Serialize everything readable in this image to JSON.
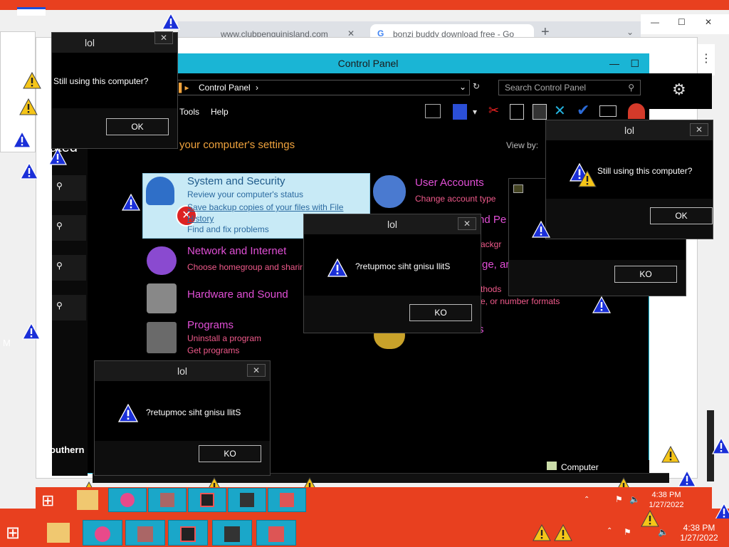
{
  "browser": {
    "tab1": "www.clubpenguinisland.com",
    "tab2": "bonzi buddy download free - Go",
    "new_tab": "+"
  },
  "control_panel": {
    "title": "Control Panel",
    "address": "Control Panel",
    "search_placeholder": "Search Control Panel",
    "menu": [
      "Tools",
      "Help"
    ],
    "heading": "your computer's settings",
    "view_by": "View by:",
    "categories": [
      {
        "title": "System and Security",
        "links": [
          "Review your computer's status",
          "Save backup copies of your files with File History",
          "Find and fix problems"
        ]
      },
      {
        "title": "Network and Internet",
        "links": [
          "Choose homegroup and sharing options"
        ]
      },
      {
        "title": "Hardware and Sound",
        "links": []
      },
      {
        "title": "Programs",
        "links": [
          "Uninstall a program",
          "Get programs"
        ]
      },
      {
        "title": "User Accounts",
        "links": [
          "Change account type"
        ]
      },
      {
        "title_fragment": "nd Pe",
        "links": [
          "ackgr"
        ]
      },
      {
        "title_fragment": "ge, ar",
        "links": [
          "thods",
          "e, or number formats"
        ]
      },
      {
        "title_fragment": "s",
        "links": []
      }
    ],
    "status_computer": "Computer"
  },
  "sidebar": {
    "fragment_top": "ated",
    "fragment_bottom": "outhern"
  },
  "dialogs": {
    "title": "lol",
    "message_normal": "Still using this computer?",
    "message_reversed": "?retupmoc siht gnisu llitS",
    "ok": "OK",
    "ko": "KO",
    "close": "✕"
  },
  "taskbar": {
    "time1": "4:38 PM",
    "date1": "1/27/2022",
    "time2": "4:38 PM",
    "date2": "1/27/2022"
  },
  "edge_letter": "M",
  "colors": {
    "accent": "#1ab5d5",
    "desktop": "#e8401f",
    "category": "#e14fd6",
    "link": "#f05a8b",
    "heading": "#f0a33d"
  }
}
